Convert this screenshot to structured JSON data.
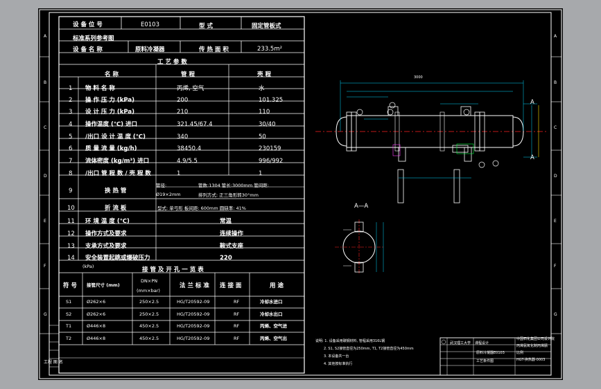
{
  "header": {
    "tag_label": "设 备 位 号",
    "tag_value": "E0103",
    "type_label": "型    式",
    "type_value": "固定管板式",
    "std_label": "标准系列参考图",
    "name_label": "设 备 名 称",
    "name_value": "原料冷凝器",
    "area_label": "传 热 面 积",
    "area_value": "233.5m²"
  },
  "process": {
    "title": "工 艺 参 数",
    "col_name": "名    称",
    "col_shell": "管   程",
    "col_tube": "壳   程",
    "rows": [
      {
        "no": "1",
        "name": "物 料 名 称",
        "shell": "丙烯, 空气",
        "tube": "水"
      },
      {
        "no": "2",
        "name": "操 作 压 力 (kPa)",
        "shell": "200",
        "tube": "101.325"
      },
      {
        "no": "3",
        "name": "设 计 压 力 (kPa)",
        "shell": "210",
        "tube": "110"
      },
      {
        "no": "4",
        "name": "操作温度 (℃)    进口",
        "shell": "321.45/67.4",
        "tube": "30/40"
      },
      {
        "no": "5",
        "name": "/出口 设 计 温 度 (℃)",
        "shell": "340",
        "tube": "50"
      },
      {
        "no": "6",
        "name": "质 量 流 量 (kg/h)",
        "shell": "38450.4",
        "tube": "230159"
      },
      {
        "no": "7",
        "name": "流体密度 (kg/m³)  进口",
        "shell": "4.9/5.5",
        "tube": "996/992"
      },
      {
        "no": "8",
        "name": "/出口 管 程 数 / 壳 程 数",
        "shell": "1",
        "tube": "1"
      }
    ],
    "row9_no": "9",
    "row9_name": "换    热    管",
    "row9_l1": "管径:",
    "row9_l2": "管数:1304 管长:3000mm 管间距:",
    "row9_l3": "Ø19×2mm",
    "row9_l4": "排列方式: 正三角形转30°mm",
    "row10_no": "10",
    "row10_name": "折    流    板",
    "row10_val": "型式: 单弓形  板间距: 600mm    圆缺率: 41%",
    "rows2": [
      {
        "no": "11",
        "name": "环 境 温 度 (℃)",
        "val": "常温"
      },
      {
        "no": "12",
        "name": "操作方式及要求",
        "val": "连续操作"
      },
      {
        "no": "13",
        "name": "支承方式及要求",
        "val": "鞍式支座"
      },
      {
        "no": "14",
        "name": "安全装置起跳或爆破压力",
        "val": "220"
      }
    ],
    "kpa": "(kPa)"
  },
  "nozzles": {
    "title": "接 管 及 开 孔 一 览 表",
    "h_no": "符 号",
    "h_size": "接管尺寸 (mm)",
    "h_dn": "DN×PN",
    "h_dn2": "(mm×bar)",
    "h_std": "法 兰 标 准",
    "h_face": "连 接 面",
    "h_use": "用    途",
    "rows": [
      {
        "no": "S1",
        "size": "Ø262×6",
        "dn": "250×2.5",
        "std": "HG/T20592-09",
        "face": "RF",
        "use": "冷却水进口"
      },
      {
        "no": "S2",
        "size": "Ø262×6",
        "dn": "250×2.5",
        "std": "HG/T20592-09",
        "face": "RF",
        "use": "冷却水出口"
      },
      {
        "no": "T1",
        "size": "Ø446×8",
        "dn": "450×2.5",
        "std": "HG/T20592-09",
        "face": "RF",
        "use": "丙烯、空气进"
      },
      {
        "no": "T2",
        "size": "Ø446×8",
        "dn": "450×2.5",
        "std": "HG/T20592-09",
        "face": "RF",
        "use": "丙烯、空气出"
      }
    ]
  },
  "drawing": {
    "section_a": "A",
    "section_aa": "A—A",
    "dim_overall": "3000",
    "notes": [
      "说明: 1. 设备采用碳钢材料, 管程采用316L钢",
      "2. S1, S2接管直径为250mm, T1, T2接管直径为450mm",
      "3. 本设备共一台",
      "4. 其他按标准执行"
    ]
  },
  "titleblock": {
    "school": "武汉理工大学",
    "dept": "课程设计",
    "company": "中国石化集团公司设计院",
    "project": "丙烯氨氧化制丙烯腈",
    "drawing_name": "工艺条件图",
    "equip": "原料冷凝器E0103",
    "drawing_no": "HGT-换热器-0003",
    "scale": "比例"
  },
  "frame": {
    "left_letters": [
      "A",
      "B",
      "C",
      "D",
      "E",
      "F",
      "G"
    ],
    "right_letters": [
      "A",
      "B",
      "C",
      "D",
      "E",
      "F",
      "G"
    ],
    "bottom_label": "工程 图 名"
  }
}
